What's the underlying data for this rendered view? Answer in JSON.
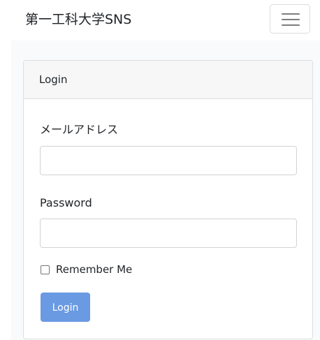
{
  "navbar": {
    "brand": "第一工科大学SNS",
    "toggler_icon": "hamburger-menu-icon"
  },
  "login_card": {
    "header": "Login",
    "email_label": "メールアドレス",
    "email_value": "",
    "password_label": "Password",
    "password_value": "",
    "remember_label": "Remember Me",
    "remember_checked": false,
    "submit_label": "Login"
  },
  "colors": {
    "primary_button": "#6a9ae2",
    "card_header_bg": "#f7f7f7",
    "page_bg": "#f8fafc"
  }
}
